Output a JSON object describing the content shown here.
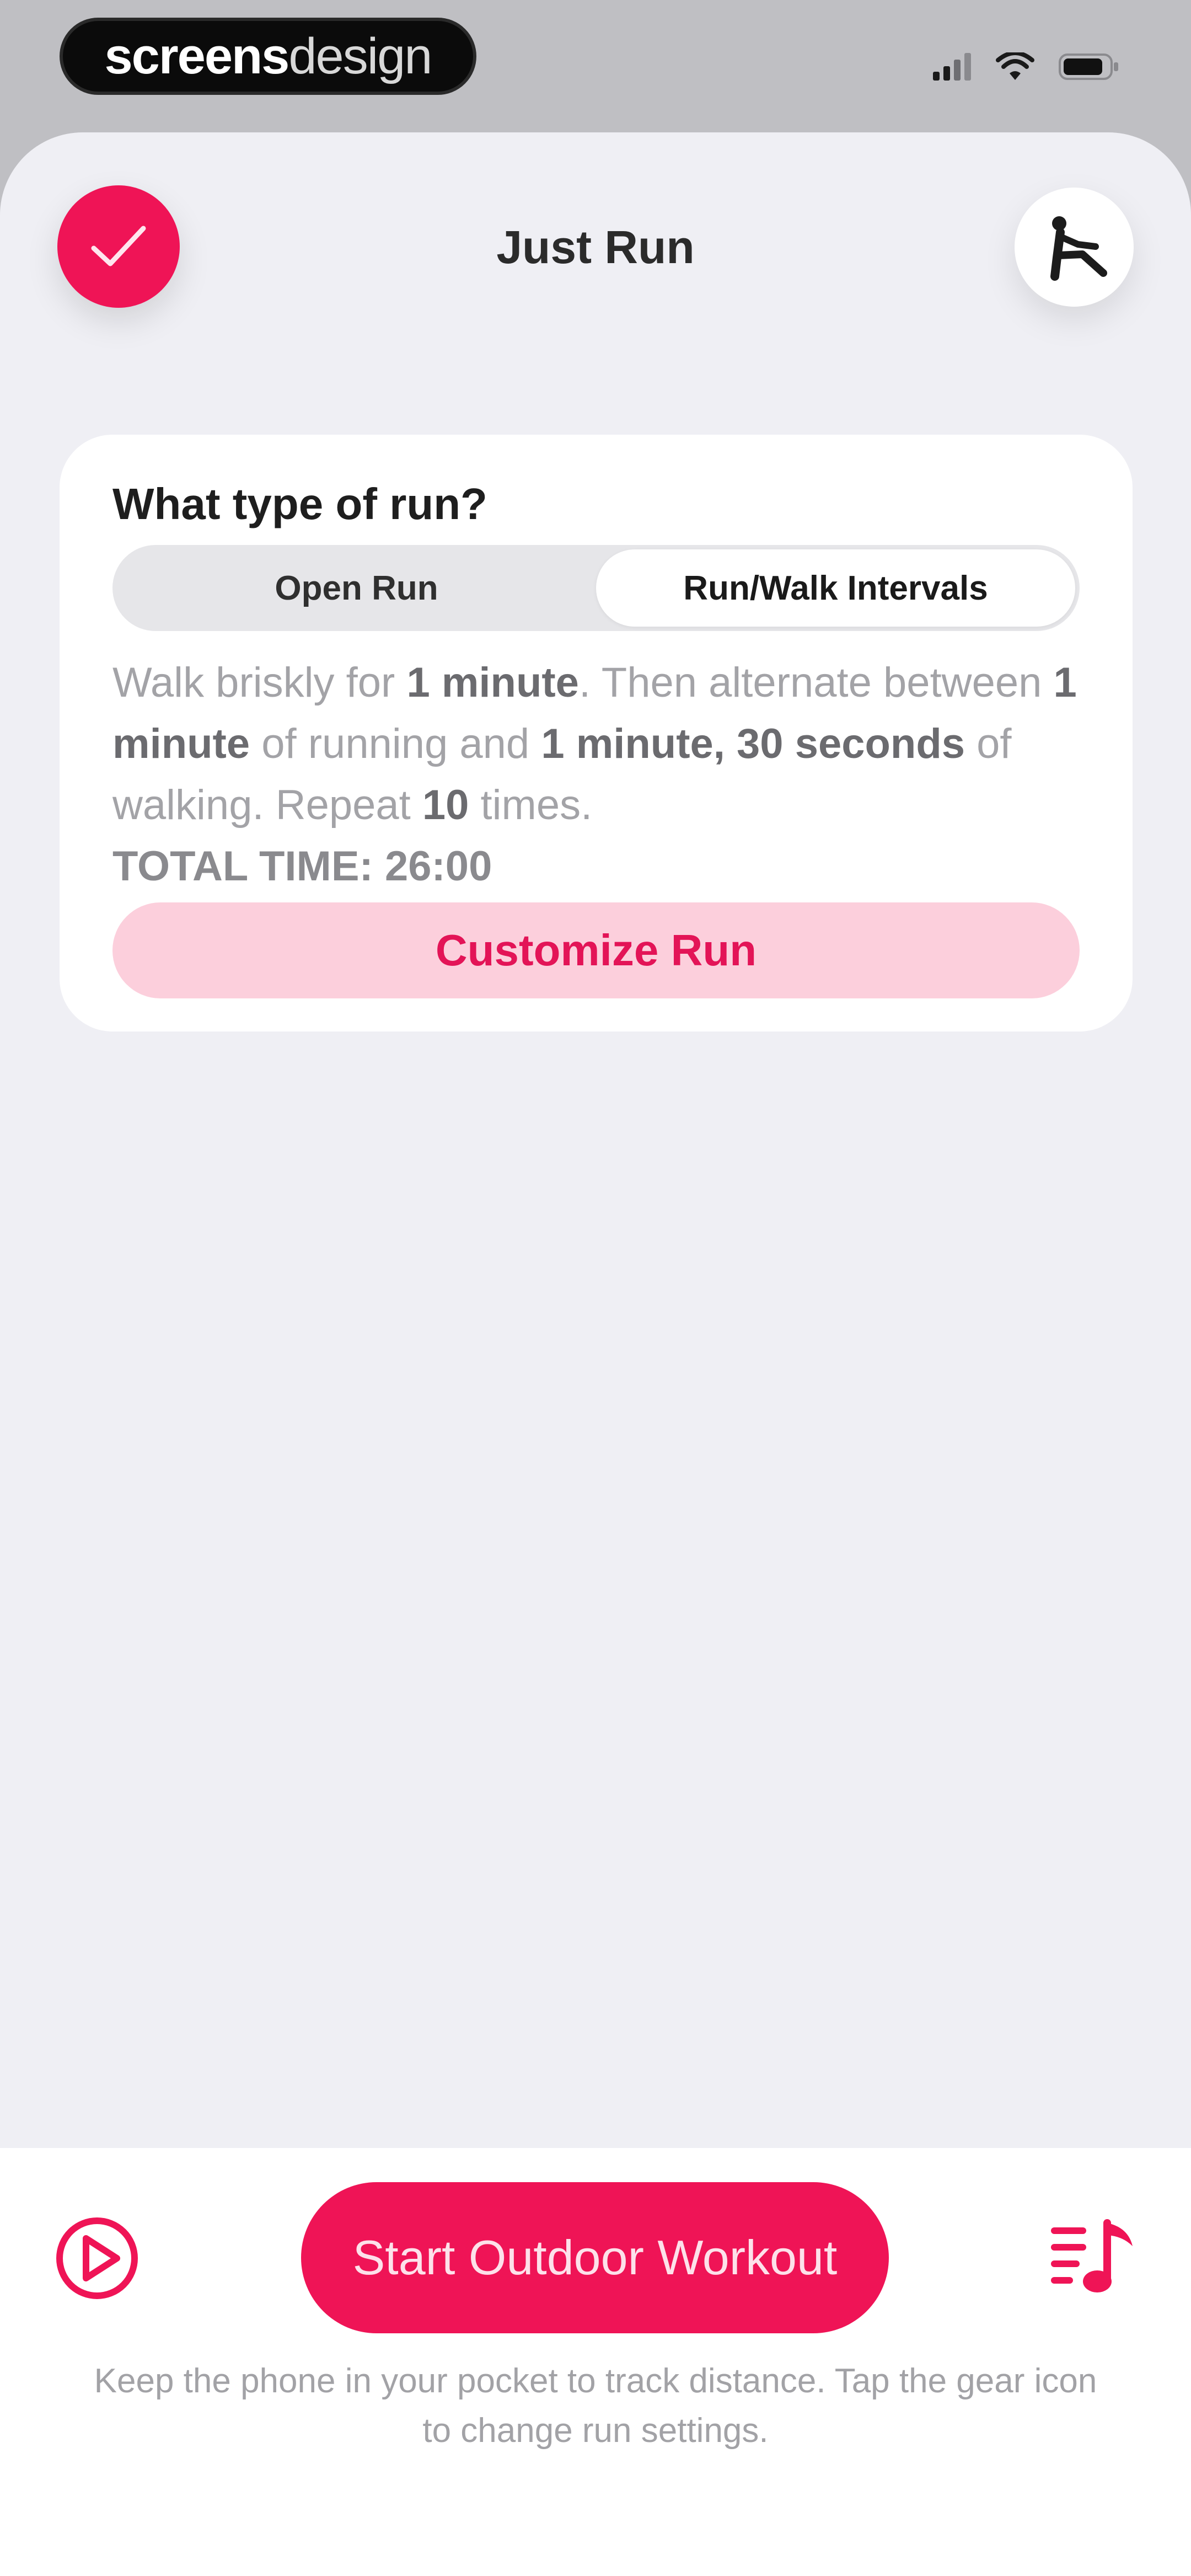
{
  "status_bar": {
    "watermark": {
      "bold": "screens",
      "light": "design"
    },
    "icons": [
      "signal-icon",
      "wifi-icon",
      "battery-icon"
    ]
  },
  "header": {
    "title": "Just Run",
    "left_icon": "checkmark-icon",
    "right_icon": "stretching-figure-icon"
  },
  "run_type": {
    "heading": "What type of run?",
    "options": [
      "Open Run",
      "Run/Walk Intervals"
    ],
    "selected": "Run/Walk Intervals",
    "description": {
      "p1": "Walk briskly for ",
      "b1": "1 minute",
      "p2": ". Then alternate between ",
      "b2": "1 minute",
      "p3": " of running and ",
      "b3": "1 minute, 30 seconds",
      "p4": " of walking. Repeat ",
      "b4": "10",
      "p5": " times."
    },
    "total_time": "TOTAL TIME: 26:00",
    "customize_label": "Customize Run"
  },
  "bottom": {
    "start_label": "Start Outdoor Workout",
    "hint": "Keep the phone in your pocket to track distance. Tap the gear icon to change run settings.",
    "left_icon": "play-circle-icon",
    "right_icon": "music-playlist-icon"
  },
  "colors": {
    "accent": "#ef1456",
    "accent_light": "#fccfdc",
    "sheet_bg": "#efeff4"
  }
}
